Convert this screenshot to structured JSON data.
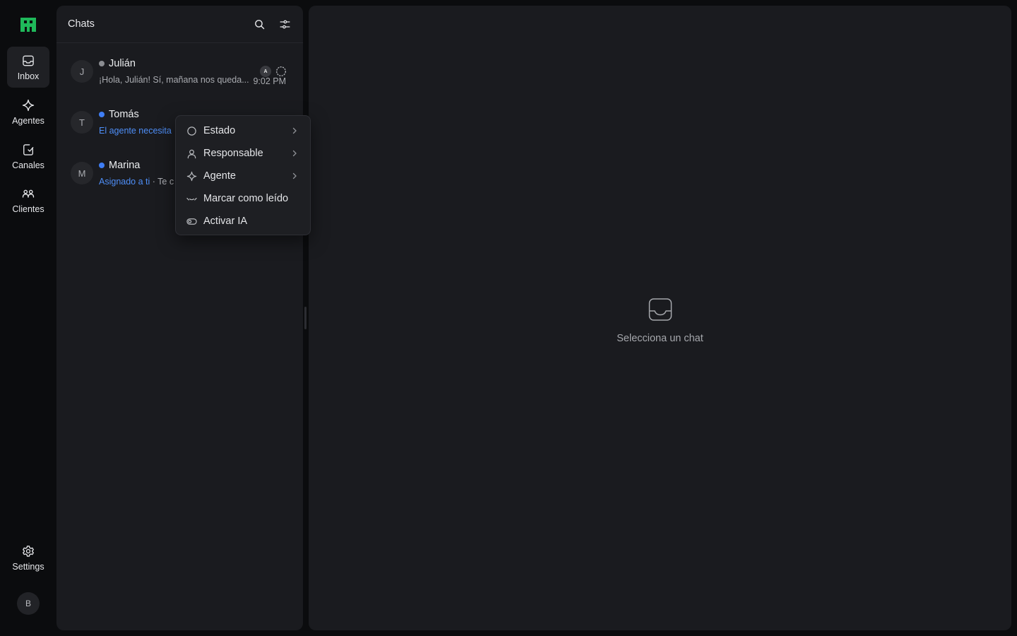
{
  "rail": {
    "items": [
      {
        "label": "Inbox",
        "icon": "inbox-icon",
        "active": true
      },
      {
        "label": "Agentes",
        "icon": "sparkle-icon"
      },
      {
        "label": "Canales",
        "icon": "channel-icon"
      },
      {
        "label": "Clientes",
        "icon": "users-icon"
      }
    ],
    "settings_label": "Settings",
    "avatar_initial": "B"
  },
  "list": {
    "title": "Chats",
    "chats": [
      {
        "initial": "J",
        "name": "Julián",
        "status_color": "#8a8c91",
        "preview": "¡Hola, Julián! Sí, mañana nos queda...",
        "time": "9:02 PM",
        "badge": "A"
      },
      {
        "initial": "T",
        "name": "Tomás",
        "status_color": "#3f7ef5",
        "preview_highlight": "El agente necesita",
        "preview": ""
      },
      {
        "initial": "M",
        "name": "Marina",
        "status_color": "#3f7ef5",
        "preview_highlight": "Asignado a ti",
        "preview": " · Te c"
      }
    ]
  },
  "main": {
    "empty_text": "Selecciona un chat"
  },
  "menu": {
    "items": [
      {
        "label": "Estado",
        "icon": "circle-icon",
        "submenu": true
      },
      {
        "label": "Responsable",
        "icon": "person-icon",
        "submenu": true
      },
      {
        "label": "Agente",
        "icon": "sparkle-icon",
        "submenu": true
      },
      {
        "label": "Marcar como leído",
        "icon": "read-icon",
        "submenu": false
      },
      {
        "label": "Activar IA",
        "icon": "toggle-icon",
        "submenu": false
      }
    ]
  },
  "colors": {
    "brand": "#22c55e",
    "accent": "#4e8ef7"
  }
}
